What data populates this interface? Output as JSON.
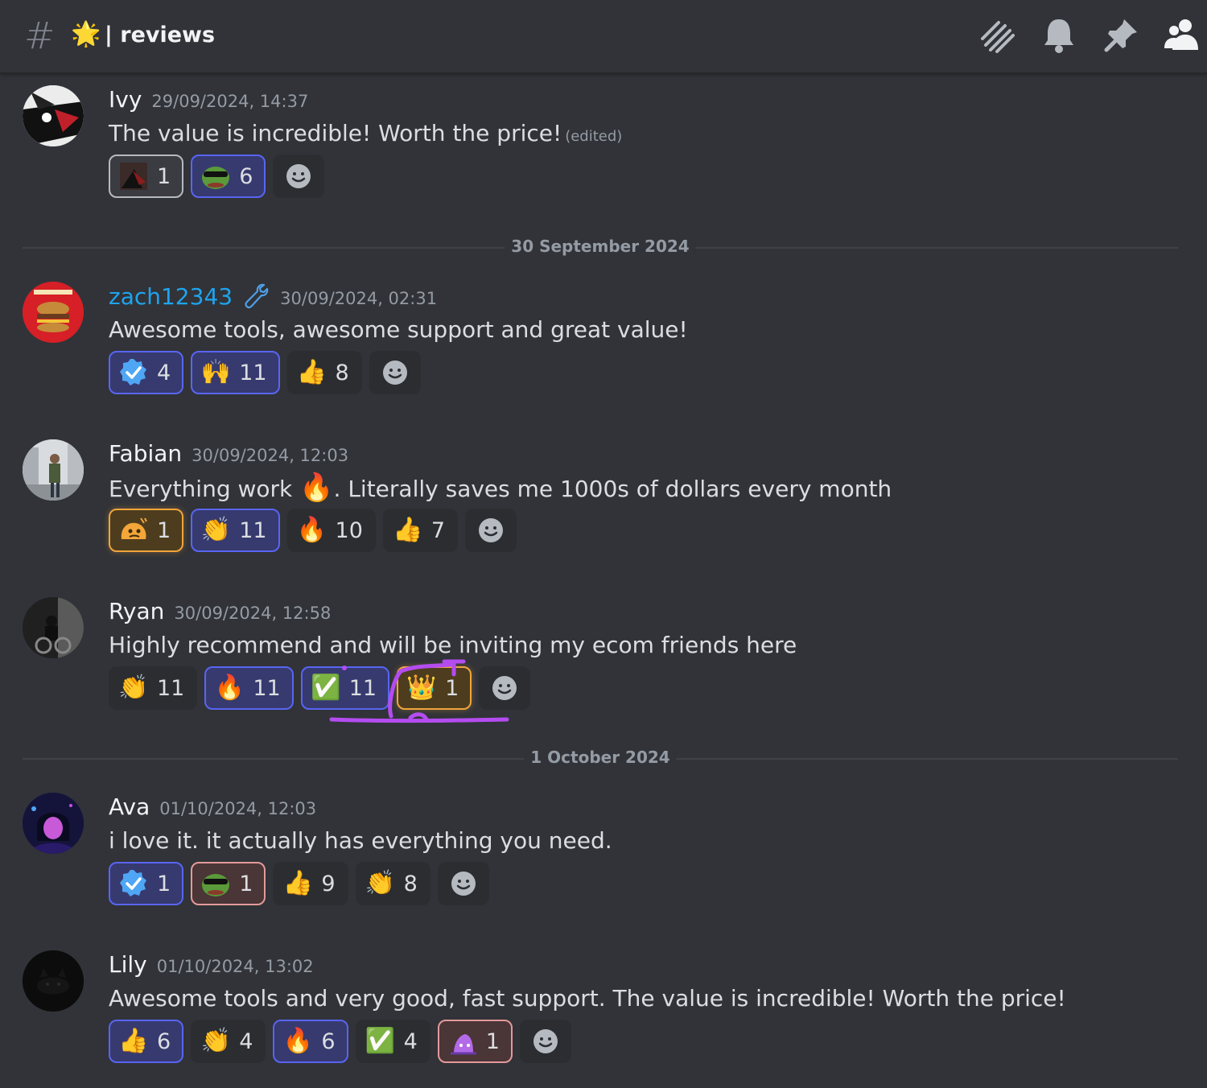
{
  "channel": {
    "hash": "#",
    "emoji": "🌟",
    "name": "| reviews",
    "icons": [
      "threads-icon",
      "bell-icon",
      "pin-icon",
      "members-icon"
    ]
  },
  "messages": [
    {
      "author": "Ivy",
      "timestamp": "29/09/2024, 14:37",
      "text": "The value is incredible! Worth the price!",
      "edited": "(edited)",
      "reactions": [
        {
          "emoji": "custom-image",
          "count": "1"
        },
        {
          "emoji": "😎",
          "count": "6"
        }
      ]
    },
    {
      "divider": "30 September 2024",
      "author": "zach12343",
      "badge": "wrench-badge-icon",
      "timestamp": "30/09/2024, 02:31",
      "text": "Awesome tools, awesome support and great value!",
      "reactions": [
        {
          "emoji": "✔",
          "count": "4"
        },
        {
          "emoji": "🙌",
          "count": "11"
        },
        {
          "emoji": "👍",
          "count": "8"
        }
      ]
    },
    {
      "author": "Fabian",
      "timestamp": "30/09/2024, 12:03",
      "text_before": "Everything work",
      "inline_emoji": "🔥",
      "text_after": ". Literally saves me 1000s of dollars every month",
      "reactions": [
        {
          "emoji": "🥺",
          "count": "1"
        },
        {
          "emoji": "👏",
          "count": "11"
        },
        {
          "emoji": "🔥",
          "count": "10"
        },
        {
          "emoji": "👍",
          "count": "7"
        }
      ]
    },
    {
      "author": "Ryan",
      "timestamp": "30/09/2024, 12:58",
      "text": "Highly recommend and will be inviting my ecom friends here",
      "reactions": [
        {
          "emoji": "👏",
          "count": "11"
        },
        {
          "emoji": "🔥",
          "count": "11"
        },
        {
          "emoji": "✅",
          "count": "11"
        },
        {
          "emoji": "👑",
          "count": "1"
        }
      ]
    },
    {
      "divider": "1 October 2024",
      "author": "Ava",
      "timestamp": "01/10/2024, 12:03",
      "text": "i love it. it actually has everything you need.",
      "reactions": [
        {
          "emoji": "✔",
          "count": "1"
        },
        {
          "emoji": "😎",
          "count": "1"
        },
        {
          "emoji": "👍",
          "count": "9"
        },
        {
          "emoji": "👏",
          "count": "8"
        }
      ]
    },
    {
      "author": "Lily",
      "timestamp": "01/10/2024, 13:02",
      "text": "Awesome tools and very good, fast support. The value is incredible! Worth the price!",
      "reactions": [
        {
          "emoji": "👍",
          "count": "6"
        },
        {
          "emoji": "👏",
          "count": "4"
        },
        {
          "emoji": "🔥",
          "count": "6"
        },
        {
          "emoji": "✅",
          "count": "4"
        },
        {
          "emoji": "🧙",
          "count": "1"
        }
      ]
    }
  ],
  "colors": {
    "background": "#313338",
    "reacted_border": "#5865f2",
    "author_role_color": "#1ea4ee",
    "annotation": "#b44cf0"
  }
}
